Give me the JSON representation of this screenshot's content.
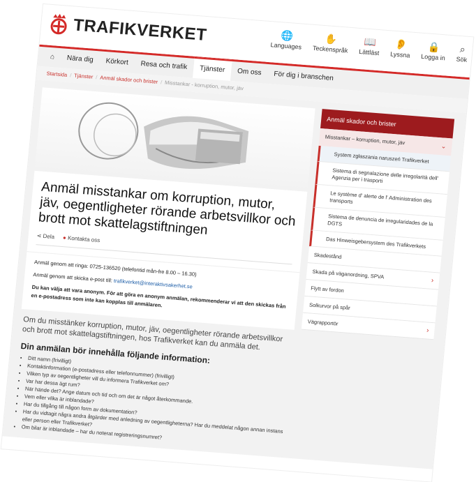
{
  "header": {
    "logo_text": "TRAFIKVERKET",
    "tools": [
      {
        "label": "Languages",
        "icon": "globe-icon",
        "glyph": "🌐"
      },
      {
        "label": "Teckenspråk",
        "icon": "sign-language-icon",
        "glyph": "✋"
      },
      {
        "label": "Lättläst",
        "icon": "easy-read-icon",
        "glyph": "📖"
      },
      {
        "label": "Lyssna",
        "icon": "listen-icon",
        "glyph": "👂"
      },
      {
        "label": "Logga in",
        "icon": "lock-icon",
        "glyph": "🔒"
      },
      {
        "label": "Sök",
        "icon": "search-icon",
        "glyph": "⌕"
      }
    ]
  },
  "nav": {
    "home_icon": "home-icon",
    "items": [
      "Nära dig",
      "Körkort",
      "Resa och trafik",
      "Tjänster",
      "Om oss",
      "För dig i branschen"
    ],
    "active": "Tjänster"
  },
  "breadcrumb": {
    "items": [
      "Startsida",
      "Tjänster",
      "Anmäl skador och brister",
      "Misstankar - korruption, mutor, jäv"
    ]
  },
  "article": {
    "title": "Anmäl misstankar om korruption, mutor, jäv, oegentligheter rörande arbetsvillkor och brott mot skattelagstiftningen",
    "share_label": "Dela",
    "contact_link": "Kontakta oss",
    "contact_phone": "Anmäl genom att ringa: 0725-136520 (telefontid mån-fre 8.00 – 16.30)",
    "contact_email_prefix": "Anmäl genom att skicka e-post till:",
    "contact_email": "trafikverket@interaktivsakerhet.se",
    "anonymous_note": "Du kan välja att vara anonym. För att göra en anonym anmälan, rekommenderar vi att den skickas från en e-postadress som inte kan kopplas till anmälaren.",
    "intro": "Om du misstänker korruption, mutor, jäv, oegentligheter rörande arbetsvillkor och brott mot skattelagstiftningen, hos Trafikverket kan du anmäla det.",
    "requirements_heading": "Din anmälan bör innehålla följande information:",
    "requirements": [
      "Ditt namn (frivilligt)",
      "Kontaktinformation (e-postadress eller telefonnummer) (frivilligt)",
      "Vilken typ av oegentligheter vill du informera Trafikverket om?",
      "Var har dessa ägt rum?",
      "När hände det? Ange datum och tid och om det är något återkommande.",
      "Vem eller vilka är inblandade?",
      "Har du tillgång till någon form av dokumentation?",
      "Har du vidtagit några andra åtgärder med anledning av oegentligheterna? Har du meddelat någon annan instans eller person eller Trafikverket?",
      "Om bilar är inblandade – har du noterat registreringsnumret?"
    ]
  },
  "sidebar": {
    "heading": "Anmäl skador och brister",
    "current": "Misstankar – korruption, mutor, jäv",
    "languages": [
      "System zgłaszania naruszeń Trafikverket",
      "Sistema di segnalazione delle irregolarità dell' Agenzia per i trasporti",
      "Le système d' alerte de l' Administration des transports",
      "Sistema de denuncia de irregularidades de la DGTS",
      "Das Hinweisgebersystem des Trafikverkets"
    ],
    "items": [
      {
        "label": "Skadestånd",
        "has_arrow": false
      },
      {
        "label": "Skada på väganordning, SPVA",
        "has_arrow": true
      },
      {
        "label": "Flytt av fordon",
        "has_arrow": false
      },
      {
        "label": "Solkurvor på spår",
        "has_arrow": false
      },
      {
        "label": "Vägrapportör",
        "has_arrow": true
      }
    ]
  },
  "colors": {
    "brand_red": "#d42a28",
    "sidebar_dark": "#9d1b1e",
    "link_blue": "#1f5fa8"
  }
}
